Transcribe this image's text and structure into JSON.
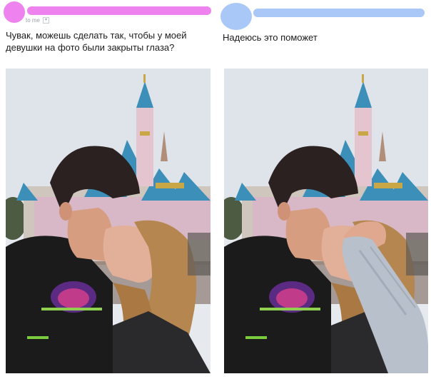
{
  "colors": {
    "left_accent": "#ee82ee",
    "right_accent": "#a9c8f7"
  },
  "left_post": {
    "meta": "to me",
    "message": "Чувак, можешь сделать так, чтобы у моей девушки на фото были закрыты глаза?"
  },
  "right_post": {
    "message": "Надеюсь это поможет"
  }
}
